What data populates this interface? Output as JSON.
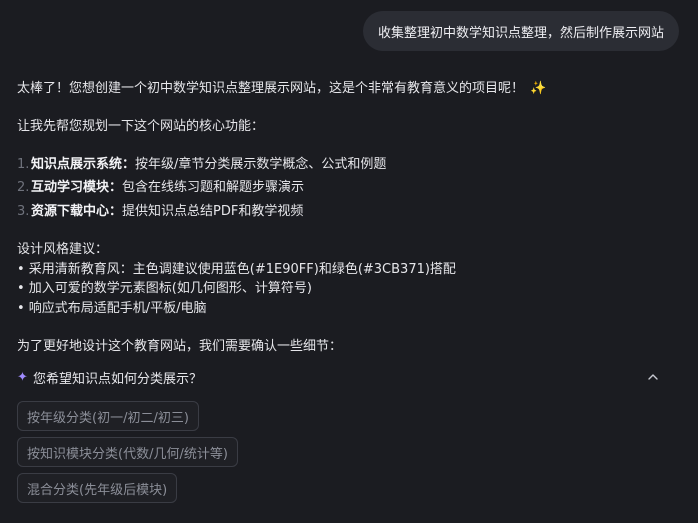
{
  "user_message": "收集整理初中数学知识点整理，然后制作展示网站",
  "assistant": {
    "intro": "太棒了！您想创建一个初中数学知识点整理展示网站，这是个非常有教育意义的项目呢！",
    "intro_emoji": "✨",
    "plan_lead": "让我先帮您规划一下这个网站的核心功能：",
    "features": [
      {
        "num": "1.",
        "title": "知识点展示系统：",
        "desc": "按年级/章节分类展示数学概念、公式和例题"
      },
      {
        "num": "2.",
        "title": "互动学习模块：",
        "desc": "包含在线练习题和解题步骤演示"
      },
      {
        "num": "3.",
        "title": "资源下载中心：",
        "desc": "提供知识点总结PDF和教学视频"
      }
    ],
    "design_title": "设计风格建议：",
    "design_points": [
      "• 采用清新教育风：主色调建议使用蓝色(#1E90FF)和绿色(#3CB371)搭配",
      "• 加入可爱的数学元素图标(如几何图形、计算符号)",
      "• 响应式布局适配手机/平板/电脑"
    ],
    "confirm_lead": "为了更好地设计这个教育网站，我们需要确认一些细节：",
    "question": {
      "icon": "sparkle-icon",
      "text": "您希望知识点如何分类展示？",
      "options": [
        "按年级分类(初一/初二/初三)",
        "按知识模块分类(代数/几何/统计等)",
        "混合分类(先年级后模块)"
      ]
    }
  }
}
